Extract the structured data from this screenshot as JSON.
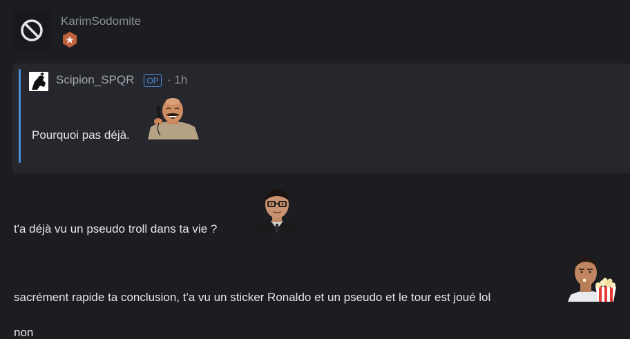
{
  "post": {
    "author": {
      "name": "KarimSodomite",
      "avatar_icon": "banned-circle-icon",
      "badge_icon": "star-shield-icon",
      "badge_color": "#c0613d"
    },
    "quote": {
      "author": "Scipion_SPQR",
      "op_label": "OP",
      "time": "· 1h",
      "text": "Pourquoi pas déjà.",
      "accent_color": "#4a90d9",
      "sticker": "laughing-man-phone-sticker"
    },
    "body": {
      "line1": "t'a déjà vu un pseudo troll dans ta vie ?",
      "line1_sticker": "glasses-boy-suit-sticker",
      "line2": "sacrément rapide ta conclusion, t'a vu un sticker Ronaldo et un pseudo et le tour est joué lol",
      "line2_sticker": "ronaldo-popcorn-sticker",
      "line3": "non"
    }
  }
}
